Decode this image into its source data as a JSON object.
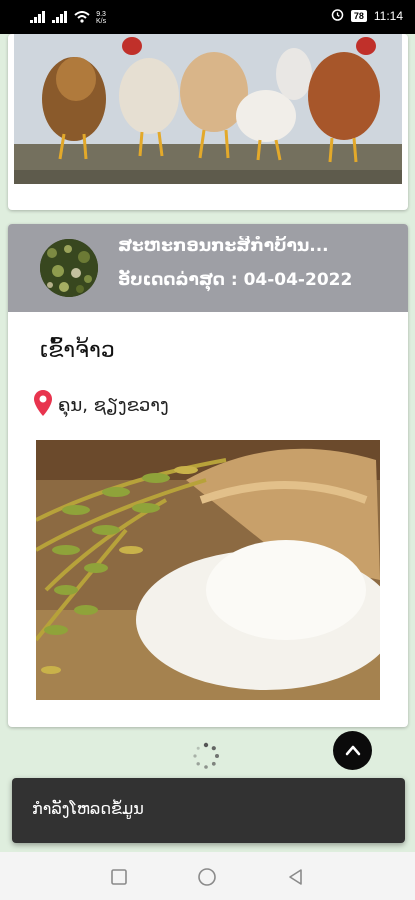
{
  "status_bar": {
    "net_speed_value": "9.3",
    "net_speed_unit": "K/s",
    "battery": "78",
    "time": "11:14"
  },
  "listing": {
    "cooperative_name": "ສະຫະກອນກະສິກຳບ້ານ...",
    "updated_label": "ອັບເດດລ່າສຸດ : 04-04-2022",
    "product_name": "ເຂົ້າຈ້າວ",
    "location": "ຄຸນ, ຊຽງຂວາງ"
  },
  "snackbar": {
    "message": "ກຳລັງໂຫລດຂໍ້ມູນ"
  },
  "colors": {
    "header_bg": "#9e9fa5",
    "page_bg": "#dfeede",
    "pin": "#e8344e",
    "snackbar_bg": "#323232"
  },
  "icons": [
    "signal-icon",
    "wifi-icon",
    "alarm-icon",
    "battery-icon",
    "location-pin-icon",
    "arrow-up-icon",
    "loading-spinner-icon",
    "nav-recents-icon",
    "nav-home-icon",
    "nav-back-icon"
  ]
}
